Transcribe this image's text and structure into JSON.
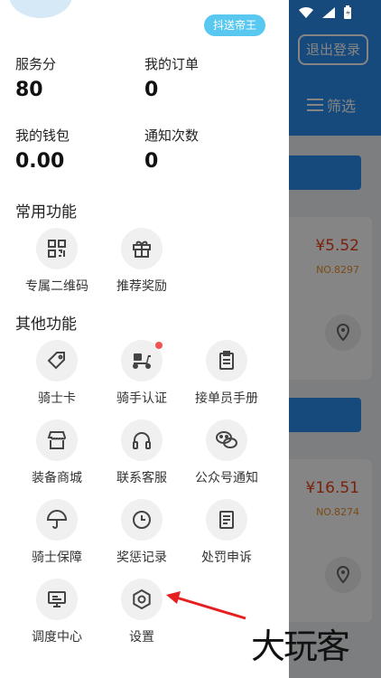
{
  "background": {
    "logout_label": "退出登录",
    "filter_label": "筛选",
    "orders": [
      {
        "price": "¥5.52",
        "no": "NO.8297"
      },
      {
        "price": "¥16.51",
        "no": "NO.8274"
      }
    ]
  },
  "drawer": {
    "badge": "抖送帝王",
    "stats": [
      {
        "label": "服务分",
        "value": "80"
      },
      {
        "label": "我的订单",
        "value": "0"
      },
      {
        "label": "我的钱包",
        "value": "0.00"
      },
      {
        "label": "通知次数",
        "value": "0"
      }
    ],
    "common_title": "常用功能",
    "common_items": [
      {
        "label": "专属二维码",
        "icon": "qr-code-icon"
      },
      {
        "label": "推荐奖励",
        "icon": "gift-icon"
      }
    ],
    "other_title": "其他功能",
    "other_items": [
      {
        "label": "骑士卡",
        "icon": "tag-icon"
      },
      {
        "label": "骑手认证",
        "icon": "scooter-icon"
      },
      {
        "label": "接单员手册",
        "icon": "clipboard-icon"
      },
      {
        "label": "装备商城",
        "icon": "store-icon"
      },
      {
        "label": "联系客服",
        "icon": "headset-icon"
      },
      {
        "label": "公众号通知",
        "icon": "wechat-icon"
      },
      {
        "label": "骑士保障",
        "icon": "umbrella-icon"
      },
      {
        "label": "奖惩记录",
        "icon": "clock-icon"
      },
      {
        "label": "处罚申诉",
        "icon": "document-icon"
      },
      {
        "label": "调度中心",
        "icon": "monitor-icon"
      },
      {
        "label": "设置",
        "icon": "gear-icon"
      }
    ]
  },
  "watermark": "大玩客"
}
